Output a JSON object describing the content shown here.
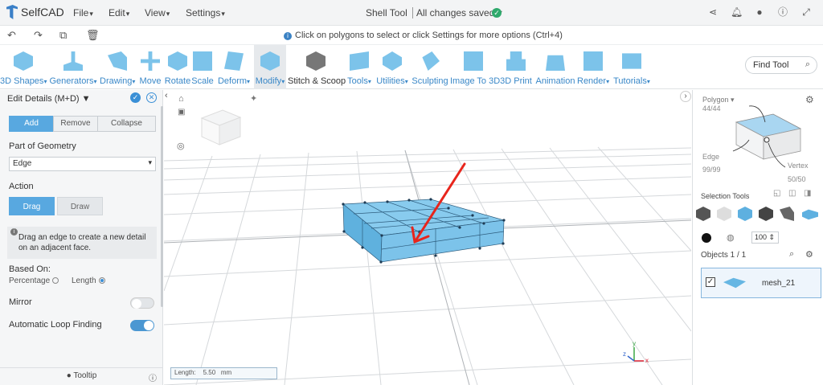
{
  "app": {
    "name": "SelfCAD"
  },
  "menus": [
    "File",
    "Edit",
    "View",
    "Settings"
  ],
  "document": {
    "title": "Shell Tool",
    "save_status": "All changes saved"
  },
  "hint": "Click on polygons to select or click Settings for more options (Ctrl+4)",
  "toolbar": [
    {
      "label": "3D Shapes",
      "dd": true,
      "icon": "cube-icon"
    },
    {
      "label": "Generators",
      "dd": true,
      "icon": "generator-icon"
    },
    {
      "label": "Drawing",
      "dd": true,
      "icon": "drawing-icon"
    },
    {
      "label": "Move",
      "dd": false,
      "icon": "move-icon"
    },
    {
      "label": "Rotate",
      "dd": false,
      "icon": "rotate-icon"
    },
    {
      "label": "Scale",
      "dd": false,
      "icon": "scale-icon"
    },
    {
      "label": "Deform",
      "dd": true,
      "icon": "deform-icon"
    },
    {
      "label": "Modify",
      "dd": true,
      "icon": "modify-icon"
    },
    {
      "label": "Stitch & Scoop",
      "dd": false,
      "icon": "stitch-icon"
    },
    {
      "label": "Tools",
      "dd": true,
      "icon": "tools-icon"
    },
    {
      "label": "Utilities",
      "dd": true,
      "icon": "utilities-icon"
    },
    {
      "label": "Sculpting",
      "dd": false,
      "icon": "sculpting-icon"
    },
    {
      "label": "Image To 3D",
      "dd": false,
      "icon": "image-to-3d-icon"
    },
    {
      "label": "3D Print",
      "dd": false,
      "icon": "3d-print-icon"
    },
    {
      "label": "Animation",
      "dd": false,
      "icon": "animation-icon"
    },
    {
      "label": "Render",
      "dd": true,
      "icon": "render-icon"
    },
    {
      "label": "Tutorials",
      "dd": true,
      "icon": "tutorials-icon"
    }
  ],
  "find_tool": "Find Tool",
  "edit_panel": {
    "title": "Edit Details (M+D)",
    "tabs": [
      "Add",
      "Remove",
      "Collapse"
    ],
    "active_tab": "Add",
    "part_label": "Part of Geometry",
    "part_value": "Edge",
    "action_label": "Action",
    "actions": [
      "Drag",
      "Draw"
    ],
    "active_action": "Drag",
    "tip": "Drag an edge to create a new detail on an adjacent face.",
    "based_on_label": "Based On:",
    "based_on_options": [
      "Percentage",
      "Length"
    ],
    "based_on_selected": "Length",
    "mirror_label": "Mirror",
    "mirror_on": false,
    "loop_label": "Automatic Loop Finding",
    "loop_on": true,
    "footer": "Tooltip"
  },
  "viewport": {
    "length_label": "Length:",
    "length_value": "5.50",
    "length_unit": "mm"
  },
  "right_panel": {
    "polygon_label": "Polygon",
    "polygon_count": "44/44",
    "edge_label": "Edge",
    "edge_count": "99/99",
    "vertex_label": "Vertex",
    "vertex_count": "50/50",
    "selection_tools_label": "Selection Tools",
    "size_value": "100",
    "objects_label": "Objects 1 / 1",
    "object_name": "mesh_21"
  },
  "colors": {
    "accent": "#3a88c8",
    "mesh": "#7cc3ea",
    "arrow": "#e8251c"
  }
}
